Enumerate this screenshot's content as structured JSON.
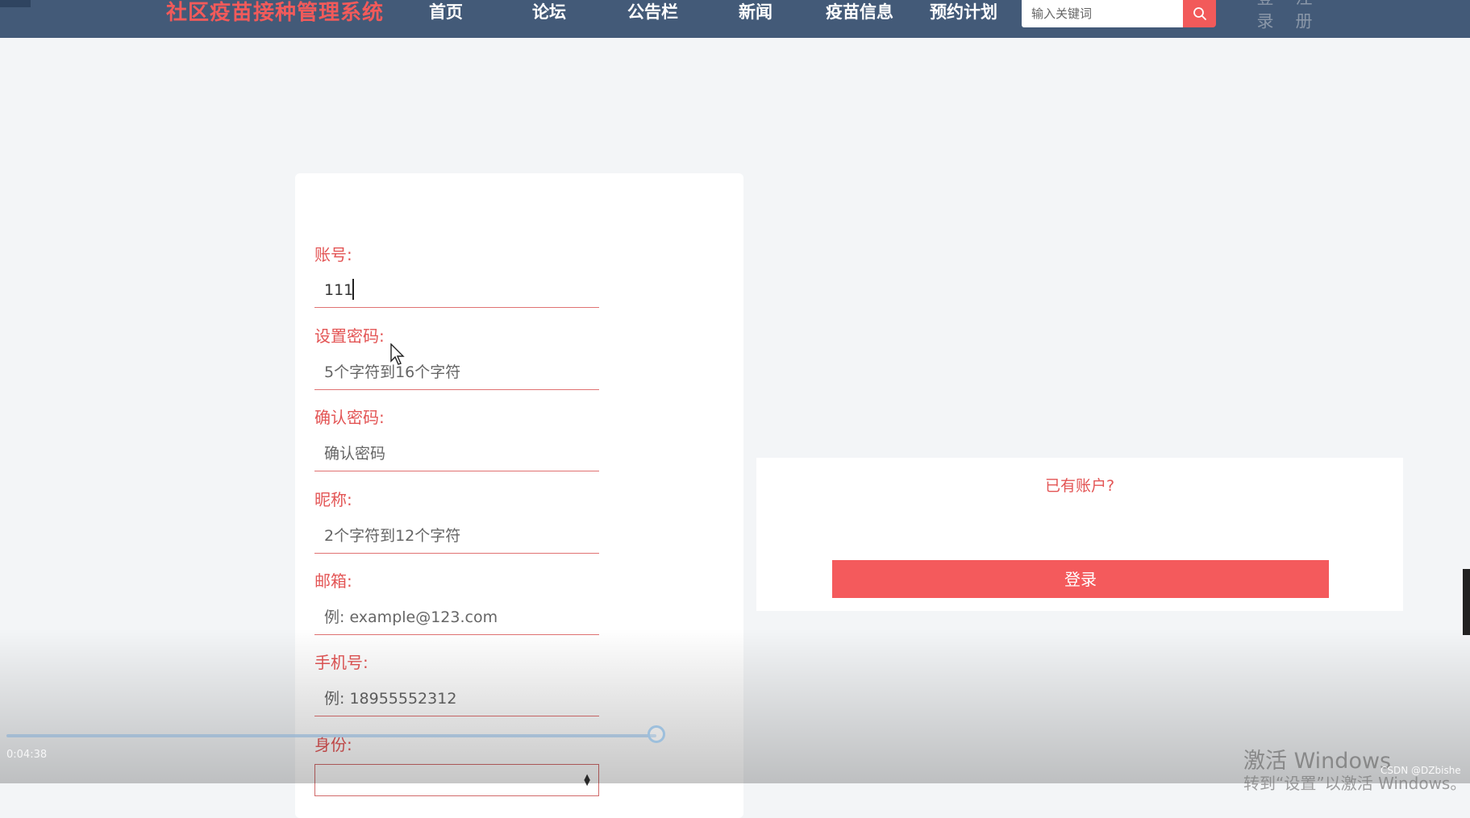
{
  "header": {
    "brand": "社区疫苗接种管理系统",
    "nav": [
      "首页",
      "论坛",
      "公告栏",
      "新闻",
      "疫苗信息",
      "预约计划"
    ],
    "search_placeholder": "输入关键词",
    "login": "登录",
    "register": "注册"
  },
  "form": {
    "account_label": "账号:",
    "account_value": "111",
    "password_label": "设置密码:",
    "password_placeholder": "5个字符到16个字符",
    "confirm_label": "确认密码:",
    "confirm_placeholder": "确认密码",
    "nickname_label": "昵称:",
    "nickname_placeholder": "2个字符到12个字符",
    "email_label": "邮箱:",
    "email_placeholder": "例: example@123.com",
    "phone_label": "手机号:",
    "phone_placeholder": "例: 18955552312",
    "role_label": "身份:"
  },
  "side": {
    "have_account": "已有账户?",
    "login_button": "登录"
  },
  "video": {
    "timecode": "0:04:38",
    "progress_fraction": 0.44
  },
  "windows": {
    "activate_title": "激活 Windows",
    "activate_sub": "转到“设置”以激活 Windows。"
  },
  "watermark": "CSDN @DZbishe",
  "colors": {
    "nav_bg": "#435a78",
    "accent": "#f25a5a"
  },
  "icons": {
    "search": "search-icon",
    "pointer": "mouse-pointer-icon"
  }
}
